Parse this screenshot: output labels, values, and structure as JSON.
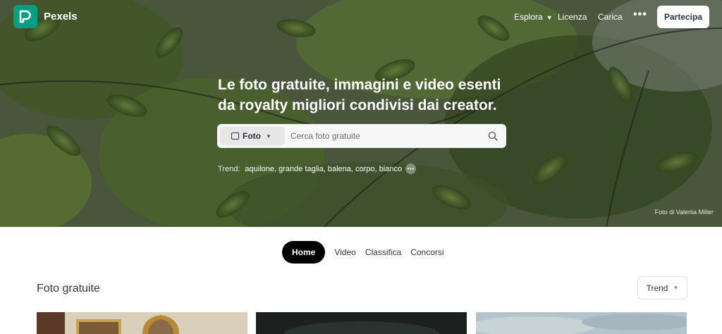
{
  "brand": {
    "name": "Pexels",
    "logo_color": "#05a081"
  },
  "nav": {
    "explore": "Esplora",
    "license": "Licenza",
    "upload": "Carica",
    "more": "•••",
    "join": "Partecipa"
  },
  "hero": {
    "title": "Le foto gratuite, immagini e video esenti da royalty migliori condivisi dai creator.",
    "search_type": "Foto",
    "search_placeholder": "Cerca foto gratuite",
    "trend_label": "Trend:",
    "trends": [
      "aquilone",
      "grande taglia",
      "balena",
      "corpo",
      "bianco"
    ],
    "credit": "Foto di Valeriia Miller"
  },
  "tabs": [
    {
      "label": "Home",
      "active": true
    },
    {
      "label": "Video",
      "active": false
    },
    {
      "label": "Classifica",
      "active": false
    },
    {
      "label": "Concorsi",
      "active": false
    }
  ],
  "section": {
    "title": "Foto gratuite",
    "sort": "Trend"
  }
}
